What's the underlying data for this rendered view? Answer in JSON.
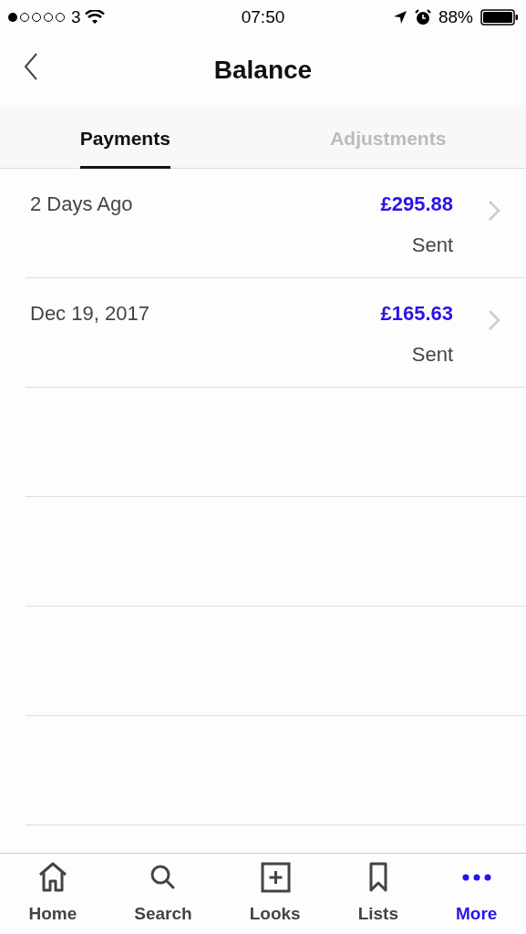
{
  "status_bar": {
    "carrier": "3",
    "time": "07:50",
    "battery": "88%"
  },
  "header": {
    "title": "Balance"
  },
  "tabs": [
    {
      "label": "Payments",
      "selected": true
    },
    {
      "label": "Adjustments",
      "selected": false
    }
  ],
  "payments": [
    {
      "date": "2 Days Ago",
      "amount": "£295.88",
      "status": "Sent"
    },
    {
      "date": "Dec 19, 2017",
      "amount": "£165.63",
      "status": "Sent"
    }
  ],
  "tab_bar": [
    {
      "label": "Home",
      "kind": "home",
      "selected": false
    },
    {
      "label": "Search",
      "kind": "search",
      "selected": false
    },
    {
      "label": "Looks",
      "kind": "looks",
      "selected": false
    },
    {
      "label": "Lists",
      "kind": "lists",
      "selected": false
    },
    {
      "label": "More",
      "kind": "more",
      "selected": true
    }
  ]
}
